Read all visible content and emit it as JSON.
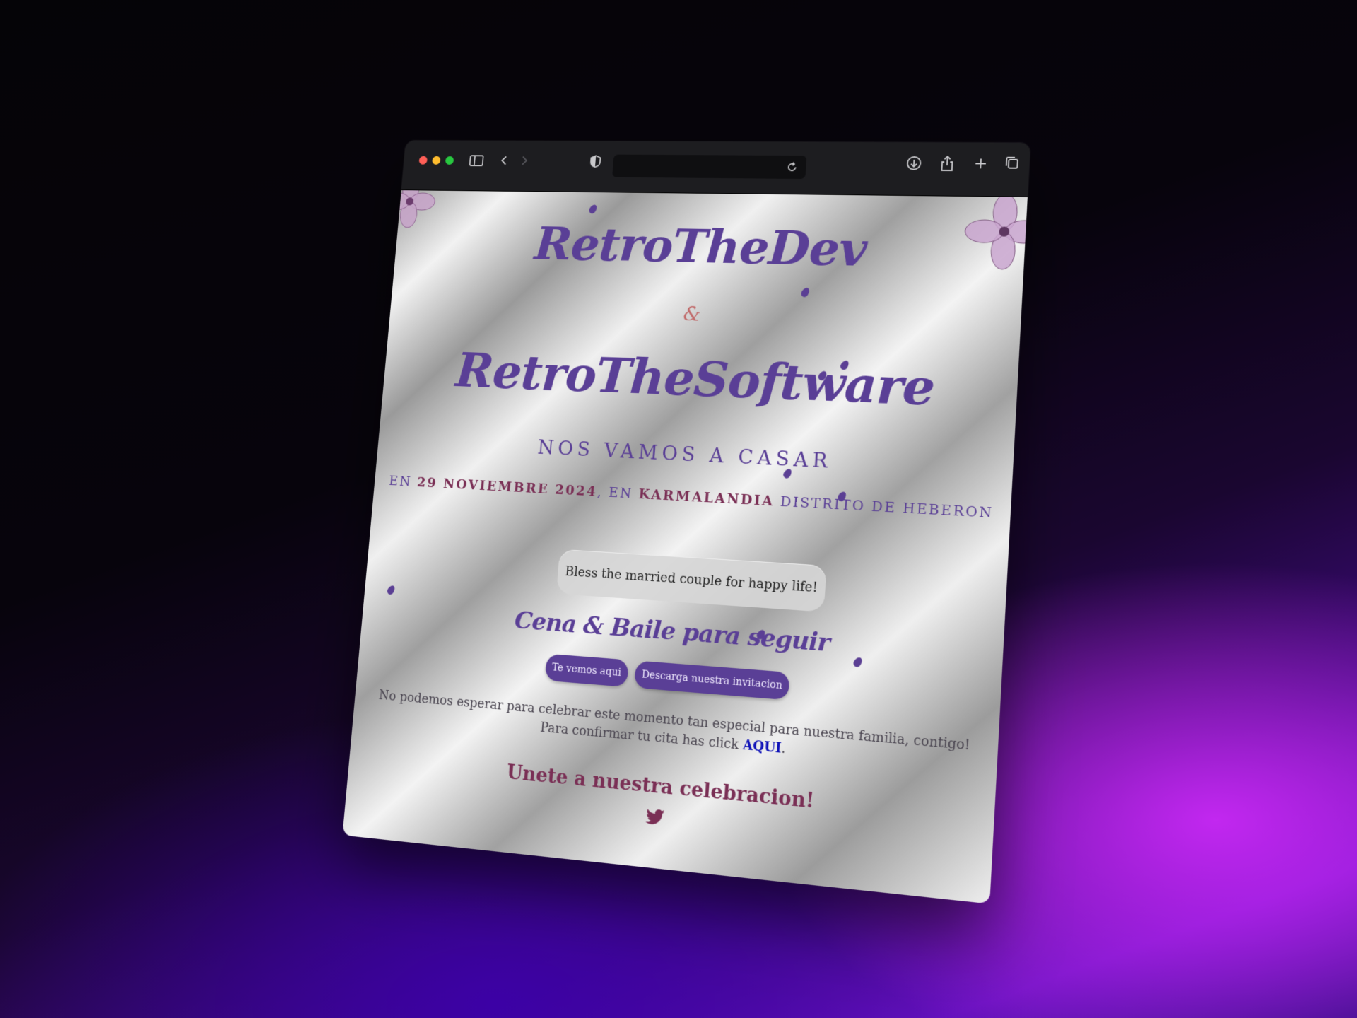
{
  "browser": {
    "icons": {
      "sidebar": "sidebar-icon",
      "back": "chevron-left-icon",
      "forward": "chevron-right-icon",
      "privacy": "shield-icon",
      "reload": "reload-icon",
      "download": "download-icon",
      "share": "share-icon",
      "new_tab": "plus-icon",
      "tabs": "tabs-overview-icon"
    },
    "address": ""
  },
  "invite": {
    "name_one": "RetroTheDev",
    "ampersand": "&",
    "name_two": "RetroTheSoftware",
    "headline": "NOS VAMOS A CASAR",
    "details": {
      "prefix": "EN ",
      "date": "29 NOVIEMBRE 2024",
      "middle": ", EN ",
      "place": "KARMALANDIA",
      "suffix": " DISTRITO DE HEBERON"
    },
    "bless_message": "Bless the married couple for happy life!",
    "section_title": "Cena & Baile para seguir",
    "buttons": {
      "see_you": "Te vemos aqui",
      "download": "Descarga nuestra invitacion"
    },
    "body": {
      "line1": "No podemos esperar para celebrar este momento tan especial para nuestra familia, contigo!",
      "line2_prefix": "Para confirmar tu cita has click ",
      "link": "AQUI",
      "line2_suffix": "."
    },
    "join": "Unete a nuestra celebracion!",
    "social_icon": "twitter-bird-icon"
  },
  "colors": {
    "accent_purple": "#5a3f96",
    "accent_wine": "#7a2f55",
    "ampersand": "#c16a6a",
    "link": "#0f12b8"
  }
}
